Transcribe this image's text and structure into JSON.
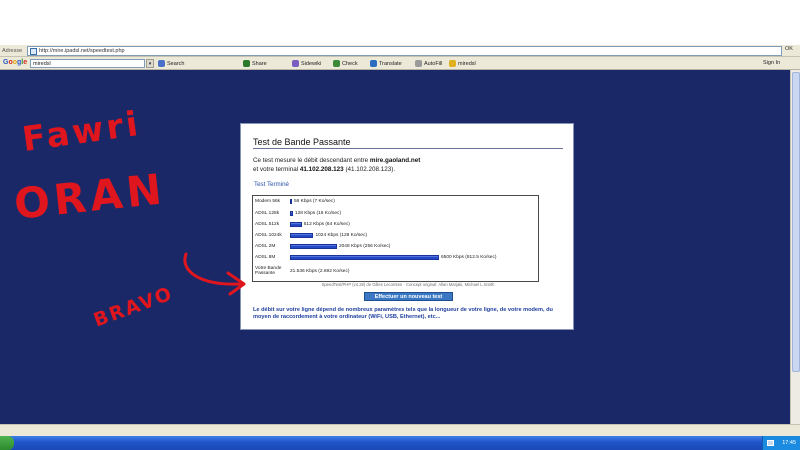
{
  "browser": {
    "address_label": "Adresse",
    "url": "http://mire.ipadsl.net/speedtest.php",
    "go_label": "OK"
  },
  "google_toolbar": {
    "logo": "Google",
    "search_value": "miredsl",
    "items": [
      {
        "label": "Search",
        "icon": "search-icon",
        "color": "#4a6fc9"
      },
      {
        "label": "Share",
        "icon": "share-icon",
        "color": "#2b7a2b"
      },
      {
        "label": "Sidewiki",
        "icon": "sidewiki-icon",
        "color": "#7a5fc0"
      },
      {
        "label": "Check",
        "icon": "check-icon",
        "color": "#3a8a3a"
      },
      {
        "label": "Translate",
        "icon": "translate-icon",
        "color": "#2b6cc0"
      },
      {
        "label": "AutoFill",
        "icon": "autofill-icon",
        "color": "#9a9a9a"
      },
      {
        "label": "miredsl",
        "icon": "highlight-icon",
        "color": "#e0b020"
      }
    ],
    "signin": "Sign In"
  },
  "panel": {
    "title": "Test de Bande Passante",
    "intro_line1_prefix": "Ce test mesure le débit descendant entre",
    "intro_line1_bold": "mire.gaoland.net",
    "intro_line2_prefix": "et votre terminal",
    "intro_line2_bold": "41.102.208.123",
    "intro_line2_suffix": "(41.102.208.123).",
    "status": "Test Terminé",
    "rows": [
      {
        "label": "Modem 56k",
        "value_text": "56 Kbps (7 Ko/sec)",
        "kbps": 56
      },
      {
        "label": "ADSL 128k",
        "value_text": "128 Kbps (16 Ko/sec)",
        "kbps": 128
      },
      {
        "label": "ADSL 512k",
        "value_text": "512 Kbps (64 Ko/sec)",
        "kbps": 512
      },
      {
        "label": "ADSL 1024k",
        "value_text": "1024 Kbps (128 Ko/sec)",
        "kbps": 1024
      },
      {
        "label": "ADSL 2M",
        "value_text": "2048 Kbps (256 Ko/sec)",
        "kbps": 2048
      },
      {
        "label": "ADSL 8M",
        "value_text": "6500 Kbps (812.5 Ko/sec)",
        "kbps": 6500
      },
      {
        "label": "Votre Bande Passante",
        "value_text": "21.536 Kbps (2.692 Ko/sec)",
        "kbps": 21.536
      }
    ],
    "credit": "SpeedTest/PHP (v4.28) de Gilles Lecomten · Concept original: Allan Marjaki, Michael L.Smith",
    "button": "Effectuer un nouveau test",
    "note": "Le débit sur votre ligne dépend de nombreux paramètres tels que la longueur de votre ligne, de votre modem, du moyen de raccordement à votre ordinateur (WiFi, USB, Ethernet), etc..."
  },
  "handwriting": {
    "line1": "Fawri",
    "line2": "ORAN",
    "line3": "BRAVO"
  },
  "taskbar": {
    "clock": "17:45"
  },
  "colors": {
    "desktop": "#1a2867",
    "annotation": "#e0161e",
    "bar": "#1c3fc0"
  }
}
